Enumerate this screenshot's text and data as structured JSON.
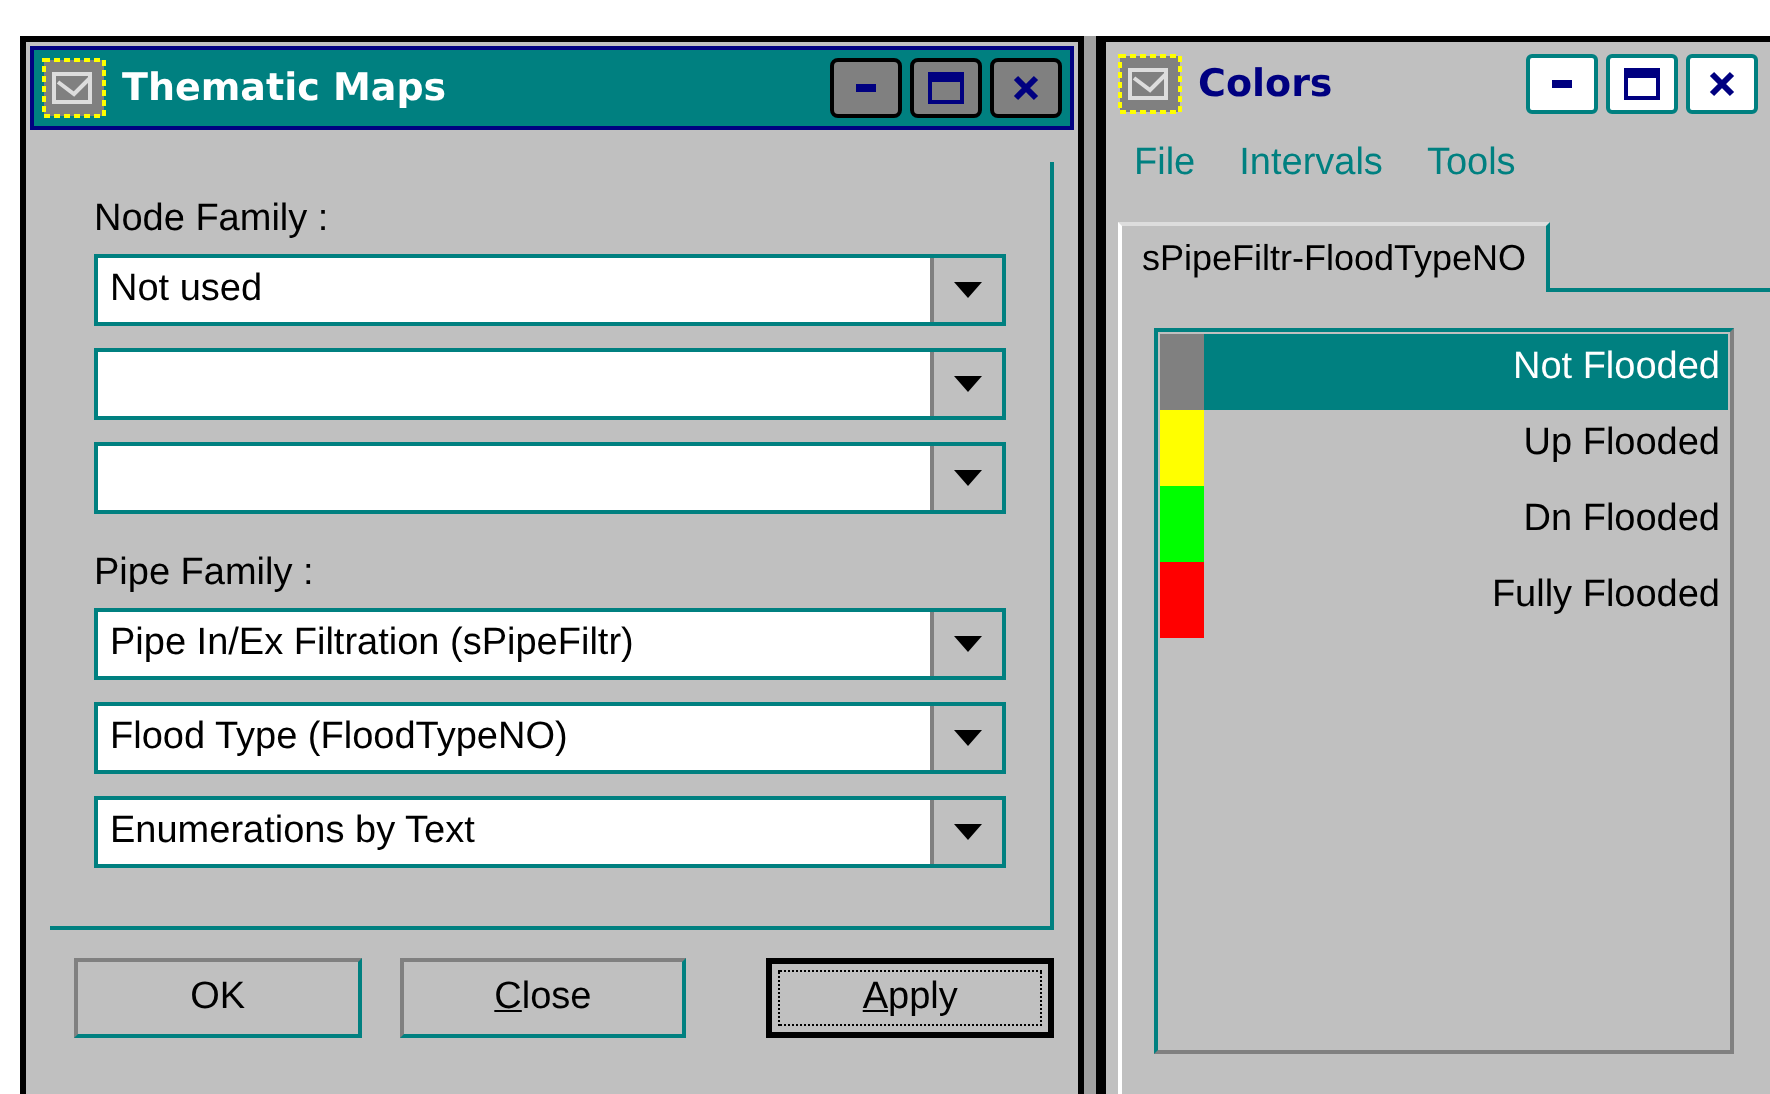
{
  "thematic_window": {
    "title": "Thematic Maps",
    "active": true,
    "groups": [
      {
        "label": "Node Family :",
        "combos": [
          {
            "kind": "filled",
            "value": "Not used"
          },
          {
            "kind": "blank"
          },
          {
            "kind": "blank"
          }
        ]
      },
      {
        "label": "Pipe Family :",
        "combos": [
          {
            "kind": "filled",
            "value": "Pipe In/Ex Filtration (sPipeFiltr)"
          },
          {
            "kind": "filled",
            "value": "Flood Type (FloodTypeNO)"
          },
          {
            "kind": "filled",
            "value": "Enumerations by Text"
          }
        ]
      }
    ],
    "buttons": [
      {
        "label": "OK",
        "default": false
      },
      {
        "label": "Close",
        "underline_first": true,
        "default": false
      },
      {
        "label": "Apply",
        "underline_first": true,
        "default": true
      }
    ]
  },
  "colors_window": {
    "title": "Colors",
    "active": false,
    "menu": [
      "File",
      "Intervals",
      "Tools"
    ],
    "tabs": [
      {
        "label": "sPipeFiltr-FloodTypeNO",
        "selected": true
      }
    ],
    "legend": [
      {
        "label": "Not Flooded",
        "color": "#808080",
        "selected": true
      },
      {
        "label": "Up Flooded",
        "color": "#ffff00",
        "selected": false
      },
      {
        "label": "Dn Flooded",
        "color": "#00ff00",
        "selected": false
      },
      {
        "label": "Fully Flooded",
        "color": "#ff0000",
        "selected": false
      }
    ]
  }
}
